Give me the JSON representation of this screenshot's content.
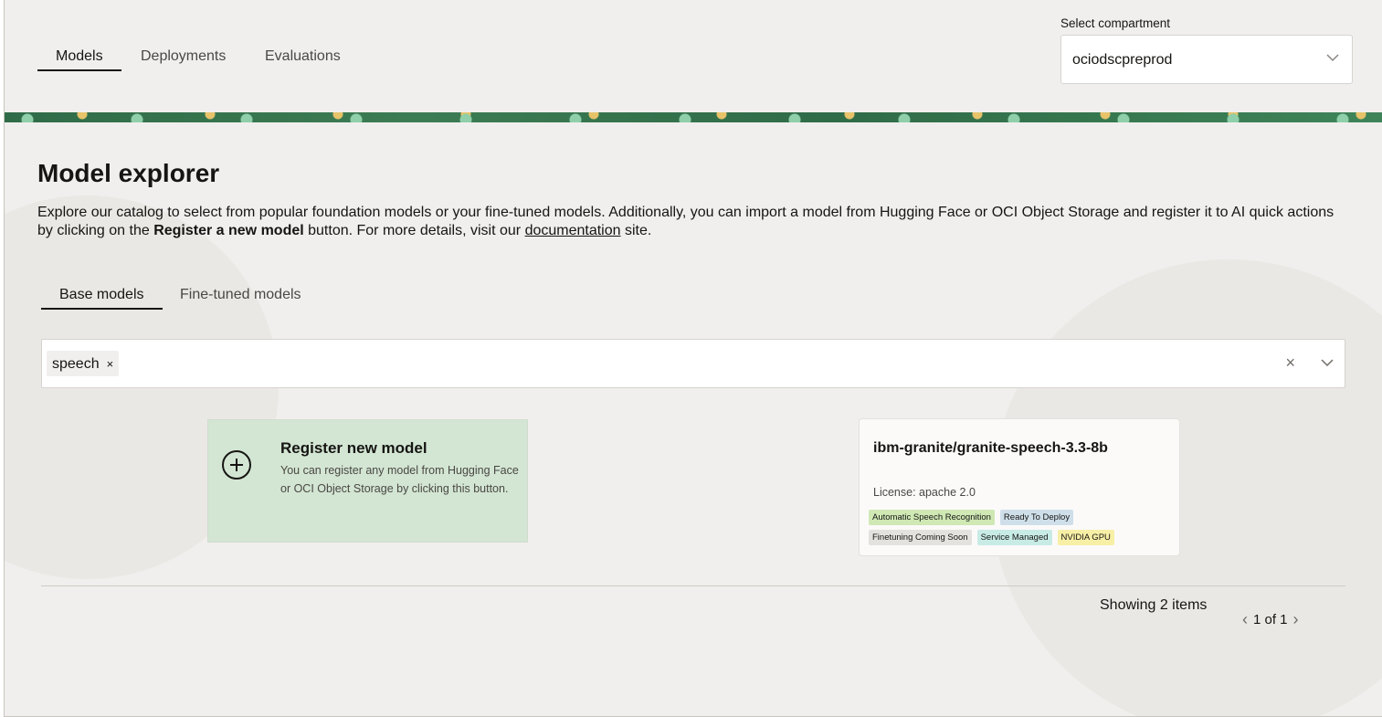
{
  "nav": {
    "tabs": [
      {
        "label": "Models"
      },
      {
        "label": "Deployments"
      },
      {
        "label": "Evaluations"
      }
    ]
  },
  "compartment": {
    "label": "Select compartment",
    "value": "ociodscpreprod"
  },
  "explorer": {
    "title": "Model explorer",
    "desc_1": "Explore our catalog to select from popular foundation models or your fine-tuned models. Additionally, you can import a model from Hugging Face or OCI Object Storage and register it to AI quick actions by clicking on the ",
    "desc_bold": "Register a new model",
    "desc_2": " button. For more details, visit our ",
    "desc_link": "documentation",
    "desc_3": " site."
  },
  "subtabs": [
    {
      "label": "Base models"
    },
    {
      "label": "Fine-tuned models"
    }
  ],
  "filter": {
    "chip": "speech",
    "chip_remove": "×",
    "clear": "×"
  },
  "register_card": {
    "title": "Register new model",
    "desc": "You can register any model from Hugging Face or OCI Object Storage by clicking this button."
  },
  "model_card": {
    "title": "ibm-granite/granite-speech-3.3-8b",
    "license": "License: apache 2.0",
    "tags": [
      {
        "label": "Automatic Speech Recognition",
        "color": "#cfe8b4"
      },
      {
        "label": "Ready To Deploy",
        "color": "#cfdfea"
      },
      {
        "label": "Finetuning Coming Soon",
        "color": "#e4e2df"
      },
      {
        "label": "Service Managed",
        "color": "#c8ebe6"
      },
      {
        "label": "NVIDIA GPU",
        "color": "#f8efa6"
      }
    ]
  },
  "pagination": {
    "showing": "Showing 2 items",
    "page": "1 of 1",
    "prev": "‹",
    "next": "›"
  }
}
